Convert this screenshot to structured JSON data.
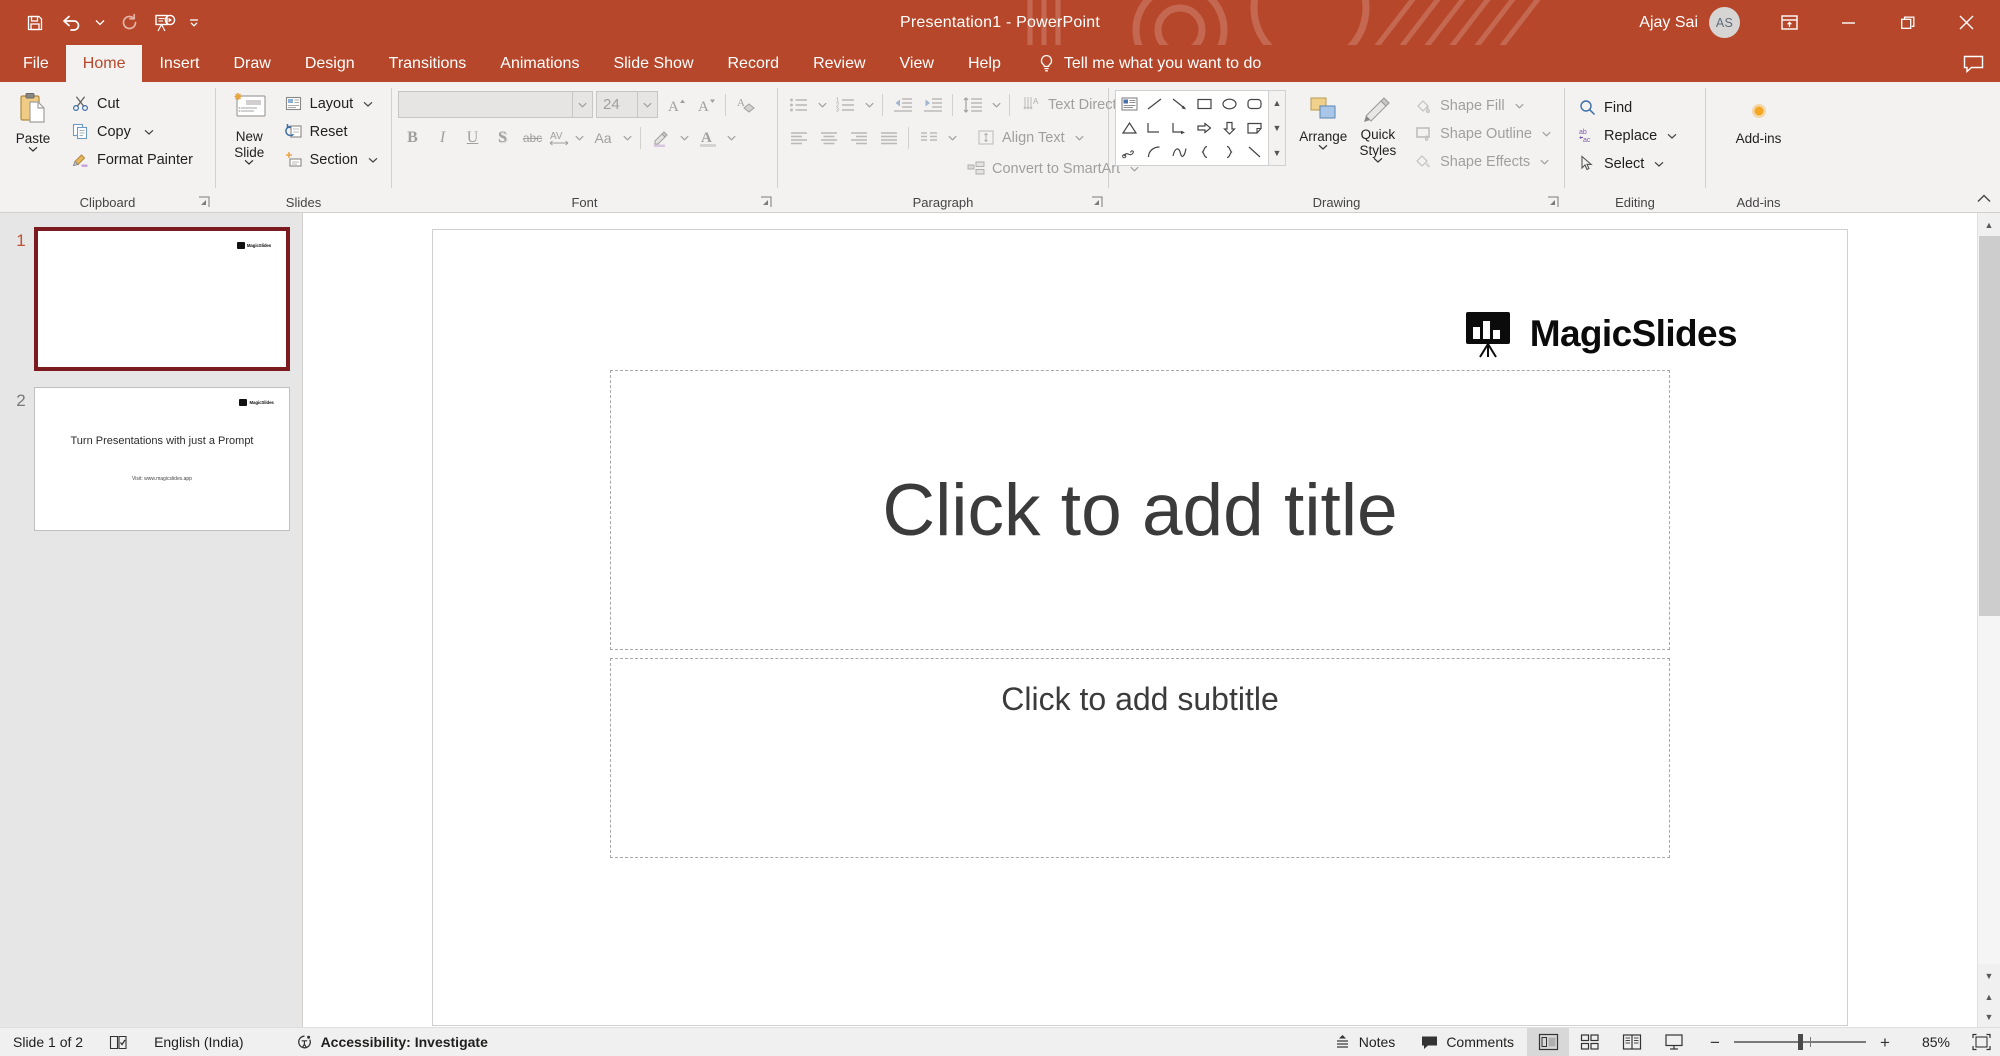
{
  "app": {
    "title": "Presentation1  -  PowerPoint",
    "account_name": "Ajay Sai",
    "account_initials": "AS",
    "accent_color": "#b7472a"
  },
  "quick_access": [
    {
      "name": "save",
      "label": "Save"
    },
    {
      "name": "undo",
      "label": "Undo"
    },
    {
      "name": "undo-dropdown",
      "label": "Undo options"
    },
    {
      "name": "redo",
      "label": "Redo"
    },
    {
      "name": "start-from-beginning",
      "label": "Start From Beginning"
    },
    {
      "name": "customize-qat",
      "label": "Customize Quick Access Toolbar"
    }
  ],
  "window_controls": {
    "ribbon_display": "Ribbon Display Options",
    "minimize": "Minimize",
    "restore": "Restore Down",
    "close": "Close"
  },
  "tabs": [
    {
      "label": "File",
      "active": false
    },
    {
      "label": "Home",
      "active": true
    },
    {
      "label": "Insert",
      "active": false
    },
    {
      "label": "Draw",
      "active": false
    },
    {
      "label": "Design",
      "active": false
    },
    {
      "label": "Transitions",
      "active": false
    },
    {
      "label": "Animations",
      "active": false
    },
    {
      "label": "Slide Show",
      "active": false
    },
    {
      "label": "Record",
      "active": false
    },
    {
      "label": "Review",
      "active": false
    },
    {
      "label": "View",
      "active": false
    },
    {
      "label": "Help",
      "active": false
    }
  ],
  "tell_me": "Tell me what you want to do",
  "ribbon": {
    "clipboard": {
      "label": "Clipboard",
      "paste": "Paste",
      "cut": "Cut",
      "copy": "Copy",
      "format_painter": "Format Painter"
    },
    "slides": {
      "label": "Slides",
      "new_slide": "New Slide",
      "layout": "Layout",
      "reset": "Reset",
      "section": "Section"
    },
    "font": {
      "label": "Font",
      "font_name": "",
      "font_name_placeholder": "",
      "font_size": "24",
      "bold": "B",
      "italic": "I",
      "underline": "U",
      "shadow": "S",
      "strikethrough": "abc",
      "char_spacing": "AV",
      "change_case": "Aa",
      "text_highlight": "Text Highlight Color",
      "font_color": "A",
      "increase_size": "Increase Font Size",
      "decrease_size": "Decrease Font Size",
      "clear_formatting": "Clear All Formatting"
    },
    "paragraph": {
      "label": "Paragraph",
      "bullets": "Bullets",
      "numbering": "Numbering",
      "decrease_indent": "Decrease Indent",
      "increase_indent": "Increase Indent",
      "line_spacing": "Line Spacing",
      "align_left": "Align Left",
      "align_center": "Center",
      "align_right": "Align Right",
      "justify": "Justify",
      "columns": "Columns",
      "text_direction": "Text Direction",
      "align_text": "Align Text",
      "convert_smartart": "Convert to SmartArt"
    },
    "drawing": {
      "label": "Drawing",
      "arrange": "Arrange",
      "quick_styles": "Quick Styles",
      "shape_fill": "Shape Fill",
      "shape_outline": "Shape Outline",
      "shape_effects": "Shape Effects",
      "shapes": [
        "textbox",
        "line",
        "line-arrow",
        "rectangle",
        "oval",
        "rounded-rectangle",
        "triangle",
        "elbow-connector",
        "elbow-arrow-connector",
        "right-arrow",
        "down-arrow",
        "folded-corner",
        "freeform-scribble",
        "arc",
        "curve",
        "left-brace",
        "right-brace",
        "diagonal-line"
      ]
    },
    "editing": {
      "label": "Editing",
      "find": "Find",
      "replace": "Replace",
      "select": "Select"
    },
    "addins": {
      "label": "Add-ins",
      "button": "Add-ins"
    }
  },
  "slides_panel": [
    {
      "number": "1",
      "selected": true,
      "logo": "MagicSlides",
      "title": "",
      "subtitle": ""
    },
    {
      "number": "2",
      "selected": false,
      "logo": "MagicSlides",
      "title": "Turn Presentations with just a Prompt",
      "subtitle": "Visit: www.magicslides.app"
    }
  ],
  "slide_canvas": {
    "logo_text": "MagicSlides",
    "title_placeholder": "Click to add title",
    "subtitle_placeholder": "Click to add subtitle"
  },
  "status_bar": {
    "slide_count": "Slide 1 of 2",
    "language": "English (India)",
    "accessibility": "Accessibility: Investigate",
    "notes": "Notes",
    "comments": "Comments",
    "views": [
      {
        "name": "normal-view",
        "label": "Normal",
        "active": true
      },
      {
        "name": "slide-sorter-view",
        "label": "Slide Sorter",
        "active": false
      },
      {
        "name": "reading-view",
        "label": "Reading View",
        "active": false
      },
      {
        "name": "slide-show-view",
        "label": "Slide Show",
        "active": false
      }
    ],
    "zoom_out": "−",
    "zoom_in": "+",
    "zoom_level": "85%",
    "fit_to_window": "Fit slide to current window"
  }
}
